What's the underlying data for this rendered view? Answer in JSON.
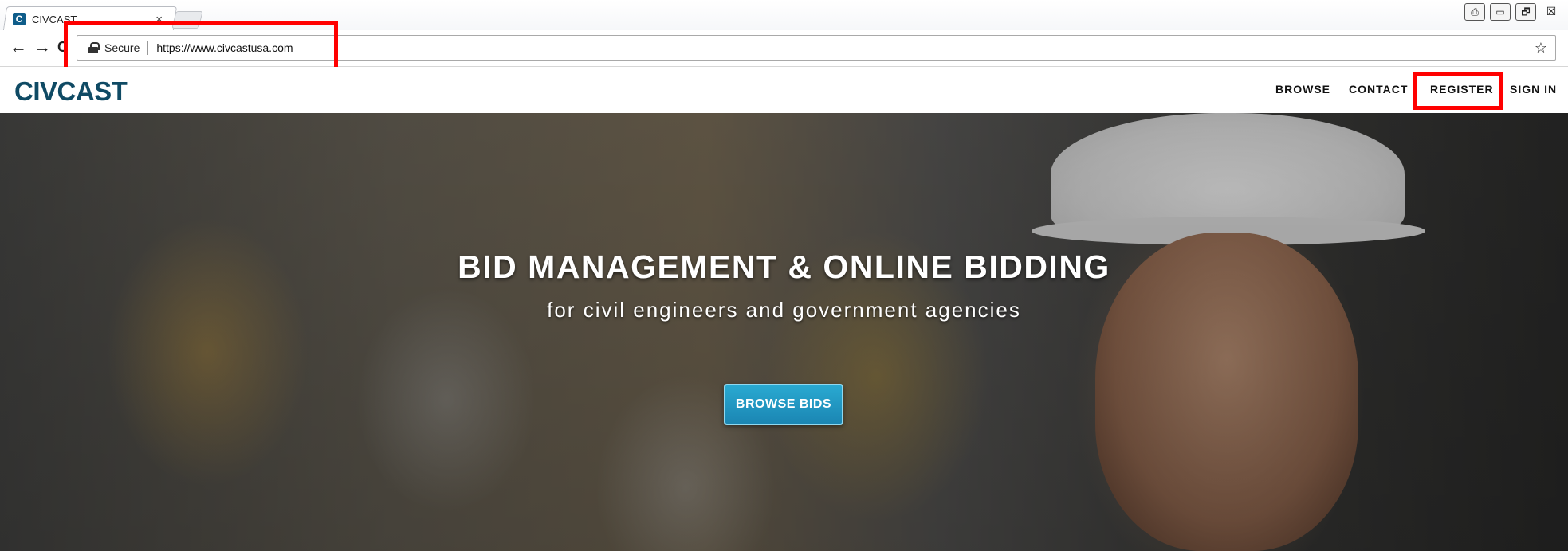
{
  "browser": {
    "tab_title": "CIVCAST",
    "favicon_letter": "C",
    "tab_close": "×",
    "back_arrow": "←",
    "forward_arrow": "→",
    "reload": "C",
    "secure_label": "Secure",
    "url": "https://www.civcastusa.com",
    "bookmark": "☆",
    "window_controls": [
      "⎙",
      "▭",
      "🗗",
      "☒"
    ],
    "icons": {
      "back": "back-arrow-icon",
      "forward": "forward-arrow-icon",
      "reload": "reload-icon",
      "lock": "lock-icon",
      "bookmark": "star-icon"
    }
  },
  "site": {
    "logo": "CIVCAST",
    "nav": [
      {
        "label": "BROWSE"
      },
      {
        "label": "CONTACT"
      },
      {
        "label": "REGISTER"
      },
      {
        "label": "SIGN IN"
      }
    ],
    "brand_color": "#0f4a64"
  },
  "hero": {
    "title": "BID MANAGEMENT & ONLINE BIDDING",
    "subtitle": "for civil engineers and government agencies",
    "cta_label": "BROWSE BIDS",
    "cta_color": "#1b96c4"
  },
  "annotations": {
    "highlight_color": "#ff0000"
  }
}
